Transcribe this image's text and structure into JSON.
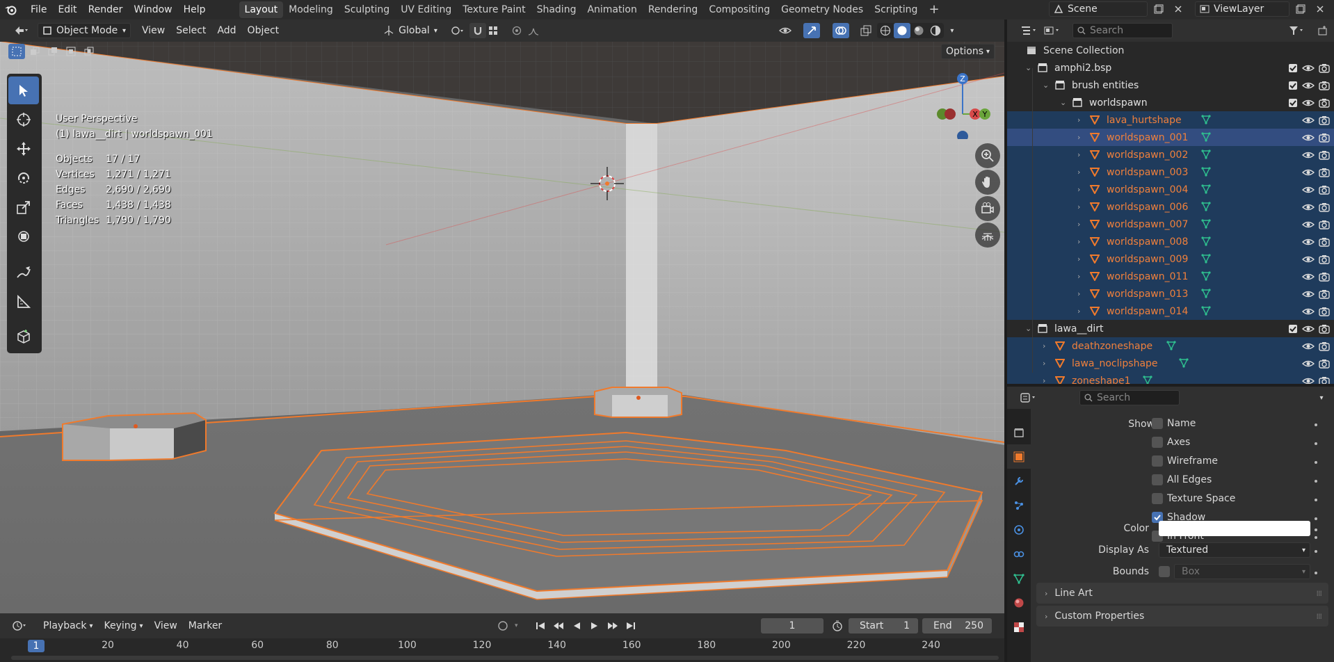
{
  "topbar": {
    "menus": [
      "File",
      "Edit",
      "Render",
      "Window",
      "Help"
    ],
    "workspaces": [
      "Layout",
      "Modeling",
      "Sculpting",
      "UV Editing",
      "Texture Paint",
      "Shading",
      "Animation",
      "Rendering",
      "Compositing",
      "Geometry Nodes",
      "Scripting"
    ],
    "active_workspace": "Layout",
    "add_tab": "+",
    "scene": "Scene",
    "view_layer": "ViewLayer"
  },
  "viewport_header": {
    "mode": "Object Mode",
    "menus": [
      "View",
      "Select",
      "Add",
      "Object"
    ],
    "orientation": "Global",
    "options": "Options"
  },
  "viewport": {
    "perspective": "User Perspective",
    "context": "(1) lawa__dirt | worldspawn_001",
    "stats": [
      {
        "label": "Objects",
        "value": "17 / 17"
      },
      {
        "label": "Vertices",
        "value": "1,271 / 1,271"
      },
      {
        "label": "Edges",
        "value": "2,690 / 2,690"
      },
      {
        "label": "Faces",
        "value": "1,438 / 1,438"
      },
      {
        "label": "Triangles",
        "value": "1,790 / 1,790"
      }
    ],
    "gizmo": {
      "z": "Z",
      "x": "X",
      "y": "Y"
    },
    "accent": "#ff7f2a"
  },
  "outliner": {
    "search_placeholder": "Search",
    "root": "Scene Collection",
    "rows": [
      {
        "name": "amphi2.bsp",
        "type": "collection",
        "indent": 0,
        "selected": false
      },
      {
        "name": "brush entities",
        "type": "collection",
        "indent": 1,
        "selected": false
      },
      {
        "name": "worldspawn",
        "type": "collection",
        "indent": 2,
        "selected": false
      },
      {
        "name": "lava_hurtshape",
        "type": "object",
        "indent": 3,
        "selected": true
      },
      {
        "name": "worldspawn_001",
        "type": "object",
        "indent": 3,
        "selected": true,
        "active": true
      },
      {
        "name": "worldspawn_002",
        "type": "object",
        "indent": 3,
        "selected": true
      },
      {
        "name": "worldspawn_003",
        "type": "object",
        "indent": 3,
        "selected": true
      },
      {
        "name": "worldspawn_004",
        "type": "object",
        "indent": 3,
        "selected": true
      },
      {
        "name": "worldspawn_006",
        "type": "object",
        "indent": 3,
        "selected": true
      },
      {
        "name": "worldspawn_007",
        "type": "object",
        "indent": 3,
        "selected": true
      },
      {
        "name": "worldspawn_008",
        "type": "object",
        "indent": 3,
        "selected": true
      },
      {
        "name": "worldspawn_009",
        "type": "object",
        "indent": 3,
        "selected": true
      },
      {
        "name": "worldspawn_011",
        "type": "object",
        "indent": 3,
        "selected": true
      },
      {
        "name": "worldspawn_013",
        "type": "object",
        "indent": 3,
        "selected": true
      },
      {
        "name": "worldspawn_014",
        "type": "object",
        "indent": 3,
        "selected": true
      },
      {
        "name": "lawa__dirt",
        "type": "collection",
        "indent": 0,
        "selected": false
      },
      {
        "name": "deathzoneshape",
        "type": "object",
        "indent": 1,
        "selected": true
      },
      {
        "name": "lawa_noclipshape",
        "type": "object",
        "indent": 1,
        "selected": true
      },
      {
        "name": "zoneshape1",
        "type": "object",
        "indent": 1,
        "selected": true
      }
    ]
  },
  "properties": {
    "search_placeholder": "Search",
    "show_label": "Show",
    "checkboxes": [
      {
        "label": "Name",
        "checked": false
      },
      {
        "label": "Axes",
        "checked": false
      },
      {
        "label": "Wireframe",
        "checked": false
      },
      {
        "label": "All Edges",
        "checked": false
      },
      {
        "label": "Texture Space",
        "checked": false
      },
      {
        "label": "Shadow",
        "checked": true
      },
      {
        "label": "In Front",
        "checked": false
      }
    ],
    "color_label": "Color",
    "color_value": "#ffffff",
    "display_as_label": "Display As",
    "display_as_value": "Textured",
    "bounds_label": "Bounds",
    "bounds_value": "Box",
    "panels": [
      "Line Art",
      "Custom Properties"
    ]
  },
  "timeline": {
    "menus": [
      "Playback",
      "Keying",
      "View",
      "Marker"
    ],
    "current_frame": "1",
    "start_label": "Start",
    "start_value": "1",
    "end_label": "End",
    "end_value": "250",
    "ruler": [
      "1",
      "20",
      "40",
      "60",
      "80",
      "100",
      "120",
      "140",
      "160",
      "180",
      "200",
      "220",
      "240"
    ]
  }
}
